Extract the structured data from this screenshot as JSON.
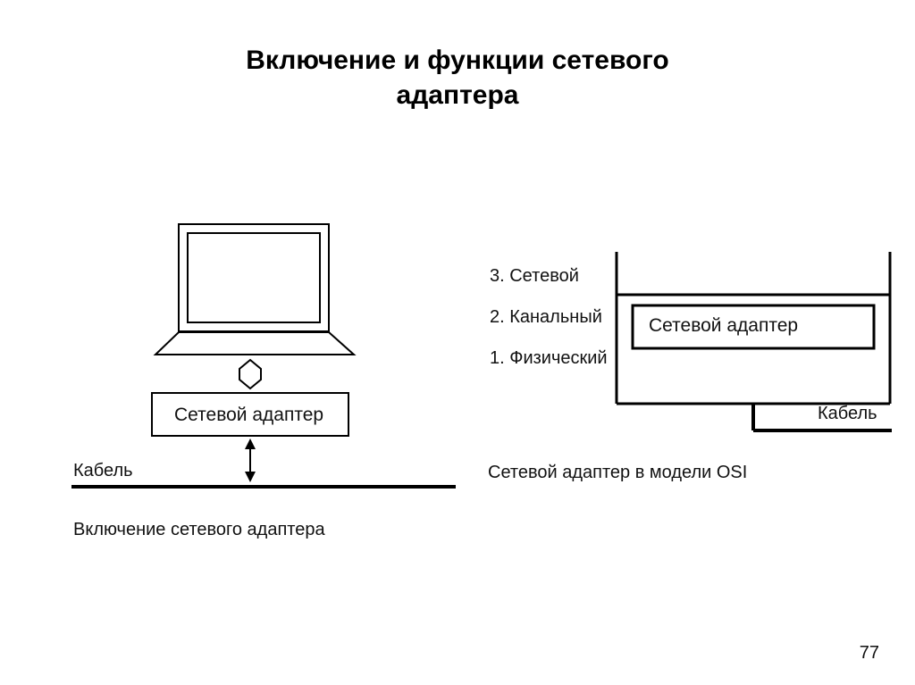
{
  "title_line1": "Включение и функции сетевого",
  "title_line2": "адаптера",
  "left": {
    "adapter_box": "Сетевой адаптер",
    "cable_label": "Кабель",
    "caption": "Включение сетевого адаптера"
  },
  "right": {
    "layers": {
      "l3": "3. Сетевой",
      "l2": "2. Канальный",
      "l1": "1. Физический"
    },
    "adapter_box": "Сетевой адаптер",
    "cable_label": "Кабель",
    "caption": "Сетевой адаптер в модели OSI"
  },
  "page_number": "77"
}
